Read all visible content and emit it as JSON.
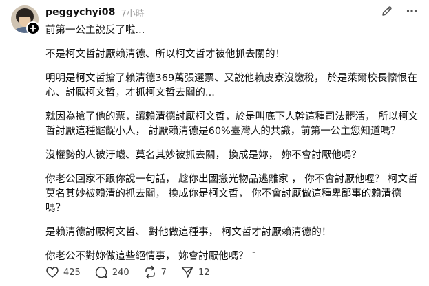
{
  "post": {
    "username": "peggychyi08",
    "time": "7小時",
    "paragraphs": [
      "前第一公主說反了啦...",
      "不是柯文哲討厭賴清德、所以柯文哲才被他抓去關的！",
      "明明是柯文哲搶了賴清德369萬張選票、又說他賴皮寮沒繳稅， 於是萊爾校長懷恨在心、討厭柯文哲，才抓柯文哲去關的...",
      "就因為搶了他的票，讓賴清德討厭柯文哲，於是叫底下人幹這種司法髒活， 所以柯文哲討厭這種齷齪小人， 討厭賴清德是60%臺灣人的共識，前第一公主您知道嗎？",
      "沒權勢的人被汙衊、莫名其妙被抓去關， 換成是妳， 妳不會討厭他嗎？",
      "你老公回家不跟你說一句話， 趁你出國搬光物品逃離家 ， 你不會討厭他喔？ 柯文哲莫名其妙被賴清的抓去關， 換成你是柯文哲， 你不會討厭做這種卑鄙事的賴清德嗎？",
      "是賴清德討厭柯文哲、 對他做這種事， 柯文哲才討厭賴清德的！",
      "你老公不對妳做這些絕情事， 妳會討厭他嗎？ ˉ"
    ]
  },
  "stats": {
    "likes": "425",
    "comments": "240",
    "reposts": "7",
    "shares": "12"
  },
  "icons": {
    "edit": "pencil-icon",
    "more": "more-icon",
    "like": "heart-icon",
    "comment": "comment-icon",
    "repost": "repost-icon",
    "share": "share-icon",
    "follow": "plus-icon"
  }
}
